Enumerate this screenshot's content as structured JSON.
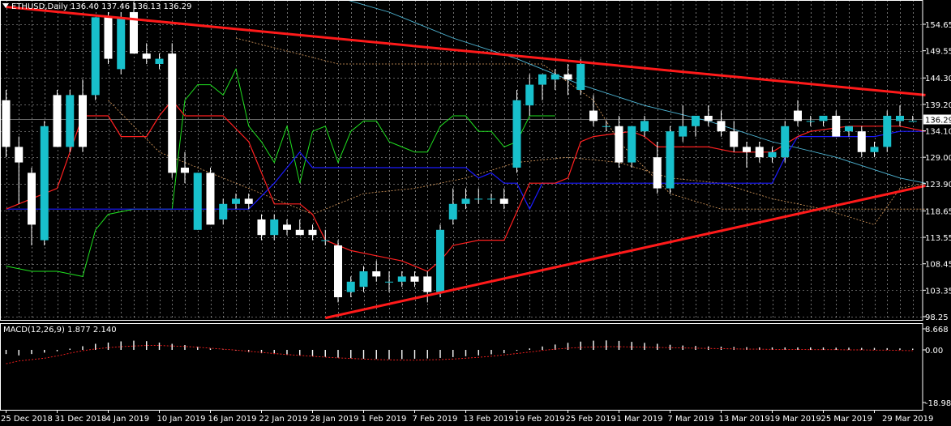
{
  "header": {
    "main_info": "ETHUSD,Daily  136.40 137.46 136.13 136.29",
    "macd_info": "MACD(12,26,9) 1.877 2.140",
    "last_price_label": "136.29"
  },
  "colors": {
    "background": "#000000",
    "frame": "#ffffff",
    "grid": "#ffffff",
    "bull_candle": "#18c0cc",
    "bear_candle": "#ffffff",
    "trendline": "#ff1a1a",
    "tenkan": "#ff2020",
    "kijun": "#1a1aff",
    "chikou": "#20e020",
    "sma": "#4fb8d8",
    "senkou": "#e0a060",
    "macd_signal": "#ff2020",
    "macd_hist": "#ffffff"
  },
  "chart_data": [
    {
      "type": "candlestick",
      "symbol": "ETHUSD",
      "timeframe": "Daily",
      "ylim": [
        98.25,
        159.9
      ],
      "y_ticks": [
        "154.65",
        "149.55",
        "144.30",
        "139.20",
        "134.10",
        "129.00",
        "123.90",
        "118.65",
        "113.55",
        "108.45",
        "103.35",
        "98.25"
      ],
      "last_price": 136.29,
      "x_labels": [
        "25 Dec 2018",
        "31 Dec 2018",
        "4 Jan 2019",
        "10 Jan 2019",
        "16 Jan 2019",
        "22 Jan 2019",
        "28 Jan 2019",
        "1 Feb 2019",
        "7 Feb 2019",
        "13 Feb 2019",
        "19 Feb 2019",
        "25 Feb 2019",
        "1 Mar 2019",
        "7 Mar 2019",
        "13 Mar 2019",
        "19 Mar 2019",
        "25 Mar 2019",
        "29 Mar 2019"
      ],
      "candles": [
        {
          "o": 140,
          "h": 142,
          "l": 129,
          "c": 131
        },
        {
          "o": 131,
          "h": 133,
          "l": 120,
          "c": 128
        },
        {
          "o": 126,
          "h": 127,
          "l": 112,
          "c": 116
        },
        {
          "o": 113,
          "h": 136,
          "l": 112,
          "c": 135
        },
        {
          "o": 141,
          "h": 142,
          "l": 131,
          "c": 131
        },
        {
          "o": 131,
          "h": 142,
          "l": 130,
          "c": 141
        },
        {
          "o": 141,
          "h": 144,
          "l": 130,
          "c": 131
        },
        {
          "o": 141,
          "h": 156,
          "l": 140,
          "c": 156
        },
        {
          "o": 156,
          "h": 157,
          "l": 147,
          "c": 148
        },
        {
          "o": 146,
          "h": 157,
          "l": 145,
          "c": 156
        },
        {
          "o": 157,
          "h": 159,
          "l": 149,
          "c": 149
        },
        {
          "o": 149,
          "h": 151,
          "l": 147,
          "c": 148
        },
        {
          "o": 147,
          "h": 149,
          "l": 146,
          "c": 148
        },
        {
          "o": 149,
          "h": 151,
          "l": 125,
          "c": 126
        },
        {
          "o": 127,
          "h": 130,
          "l": 124,
          "c": 126
        },
        {
          "o": 115,
          "h": 126,
          "l": 115,
          "c": 126
        },
        {
          "o": 126,
          "h": 127,
          "l": 116,
          "c": 116
        },
        {
          "o": 117,
          "h": 121,
          "l": 116,
          "c": 120
        },
        {
          "o": 120,
          "h": 122,
          "l": 119,
          "c": 121
        },
        {
          "o": 121,
          "h": 122,
          "l": 119,
          "c": 120
        },
        {
          "o": 117,
          "h": 118,
          "l": 113,
          "c": 114
        },
        {
          "o": 114,
          "h": 118,
          "l": 113,
          "c": 117
        },
        {
          "o": 116,
          "h": 117,
          "l": 114,
          "c": 115
        },
        {
          "o": 115,
          "h": 117,
          "l": 114,
          "c": 114
        },
        {
          "o": 115,
          "h": 116,
          "l": 113,
          "c": 114
        },
        {
          "o": 113,
          "h": 115,
          "l": 112,
          "c": 113
        },
        {
          "o": 112,
          "h": 113,
          "l": 101,
          "c": 102
        },
        {
          "o": 103,
          "h": 106,
          "l": 102,
          "c": 105
        },
        {
          "o": 104,
          "h": 108,
          "l": 103,
          "c": 107
        },
        {
          "o": 107,
          "h": 109,
          "l": 105,
          "c": 106
        },
        {
          "o": 105,
          "h": 107,
          "l": 103,
          "c": 105
        },
        {
          "o": 105,
          "h": 107,
          "l": 104,
          "c": 106
        },
        {
          "o": 106,
          "h": 107,
          "l": 104,
          "c": 105
        },
        {
          "o": 106,
          "h": 107,
          "l": 101,
          "c": 103
        },
        {
          "o": 103,
          "h": 116,
          "l": 102,
          "c": 115
        },
        {
          "o": 117,
          "h": 123,
          "l": 116,
          "c": 120
        },
        {
          "o": 120,
          "h": 123,
          "l": 119,
          "c": 121
        },
        {
          "o": 121,
          "h": 123,
          "l": 120,
          "c": 121
        },
        {
          "o": 121,
          "h": 122,
          "l": 120,
          "c": 121
        },
        {
          "o": 121,
          "h": 123,
          "l": 119,
          "c": 120
        },
        {
          "o": 127,
          "h": 142,
          "l": 126,
          "c": 140
        },
        {
          "o": 139,
          "h": 145,
          "l": 137,
          "c": 143
        },
        {
          "o": 143,
          "h": 145,
          "l": 140,
          "c": 145
        },
        {
          "o": 144,
          "h": 146,
          "l": 142,
          "c": 145
        },
        {
          "o": 145,
          "h": 147,
          "l": 141,
          "c": 144
        },
        {
          "o": 142,
          "h": 148,
          "l": 141,
          "c": 147
        },
        {
          "o": 138,
          "h": 141,
          "l": 135,
          "c": 136
        },
        {
          "o": 135,
          "h": 136,
          "l": 134,
          "c": 135
        },
        {
          "o": 135,
          "h": 137,
          "l": 127,
          "c": 128
        },
        {
          "o": 128,
          "h": 135,
          "l": 127,
          "c": 135
        },
        {
          "o": 134,
          "h": 137,
          "l": 133,
          "c": 136
        },
        {
          "o": 129,
          "h": 132,
          "l": 122,
          "c": 123
        },
        {
          "o": 123,
          "h": 135,
          "l": 122,
          "c": 134
        },
        {
          "o": 133,
          "h": 139,
          "l": 132,
          "c": 135
        },
        {
          "o": 135,
          "h": 137,
          "l": 133,
          "c": 137
        },
        {
          "o": 137,
          "h": 139,
          "l": 135,
          "c": 136
        },
        {
          "o": 136,
          "h": 138,
          "l": 133,
          "c": 134
        },
        {
          "o": 134,
          "h": 136,
          "l": 130,
          "c": 131
        },
        {
          "o": 131,
          "h": 132,
          "l": 127,
          "c": 130
        },
        {
          "o": 131,
          "h": 132,
          "l": 128,
          "c": 129
        },
        {
          "o": 129,
          "h": 131,
          "l": 128,
          "c": 130
        },
        {
          "o": 129,
          "h": 136,
          "l": 128,
          "c": 135
        },
        {
          "o": 138,
          "h": 140,
          "l": 135,
          "c": 136
        },
        {
          "o": 136,
          "h": 137,
          "l": 135,
          "c": 136
        },
        {
          "o": 136,
          "h": 137,
          "l": 135,
          "c": 137
        },
        {
          "o": 137,
          "h": 138,
          "l": 133,
          "c": 133
        },
        {
          "o": 134,
          "h": 135,
          "l": 133,
          "c": 135
        },
        {
          "o": 134,
          "h": 135,
          "l": 129,
          "c": 130
        },
        {
          "o": 130,
          "h": 132,
          "l": 129,
          "c": 131
        },
        {
          "o": 131,
          "h": 138,
          "l": 130,
          "c": 137
        },
        {
          "o": 136,
          "h": 139,
          "l": 135,
          "c": 137
        },
        {
          "o": 136,
          "h": 137,
          "l": 136,
          "c": 136
        }
      ],
      "overlays": {
        "trendline_upper": [
          [
            0,
            158
          ],
          [
            72,
            141
          ]
        ],
        "trendline_lower": [
          [
            25,
            98
          ],
          [
            72,
            123.5
          ]
        ],
        "kijun_sen": [
          [
            0,
            119
          ],
          [
            12,
            119
          ],
          [
            15,
            119
          ],
          [
            19,
            119
          ],
          [
            21,
            124
          ],
          [
            23,
            130
          ],
          [
            24,
            127
          ],
          [
            26,
            127
          ],
          [
            33,
            127
          ],
          [
            36,
            127
          ],
          [
            37,
            125
          ],
          [
            38,
            126
          ],
          [
            39,
            124
          ],
          [
            40,
            124
          ],
          [
            41,
            119
          ],
          [
            42,
            124
          ],
          [
            50,
            124
          ],
          [
            60,
            124
          ],
          [
            61,
            129
          ],
          [
            62,
            133
          ],
          [
            68,
            133
          ],
          [
            70,
            134
          ],
          [
            72,
            134
          ]
        ],
        "tenkan_sen": [
          [
            0,
            119
          ],
          [
            4,
            123
          ],
          [
            6,
            137
          ],
          [
            8,
            137
          ],
          [
            9,
            133
          ],
          [
            10,
            133
          ],
          [
            11,
            133
          ],
          [
            12,
            137
          ],
          [
            13,
            140
          ],
          [
            14,
            137
          ],
          [
            17,
            137
          ],
          [
            19,
            132
          ],
          [
            21,
            120
          ],
          [
            23,
            120
          ],
          [
            24,
            118
          ],
          [
            25,
            113
          ],
          [
            27,
            111
          ],
          [
            29,
            110
          ],
          [
            31,
            109
          ],
          [
            32,
            108
          ],
          [
            33,
            107
          ],
          [
            34,
            109
          ],
          [
            35,
            112
          ],
          [
            37,
            113
          ],
          [
            39,
            113
          ],
          [
            41,
            124
          ],
          [
            42,
            124
          ],
          [
            43,
            124
          ],
          [
            44,
            125
          ],
          [
            45,
            132
          ],
          [
            46,
            133
          ],
          [
            49,
            134
          ],
          [
            50,
            133
          ],
          [
            51,
            131
          ],
          [
            53,
            131
          ],
          [
            55,
            131
          ],
          [
            57,
            130
          ],
          [
            60,
            130
          ],
          [
            62,
            133
          ],
          [
            63,
            134
          ],
          [
            66,
            135
          ],
          [
            70,
            135
          ],
          [
            72,
            134
          ]
        ],
        "chikou_span": [
          [
            0,
            108
          ],
          [
            2,
            107
          ],
          [
            4,
            107
          ],
          [
            6,
            106
          ],
          [
            7,
            115
          ],
          [
            8,
            118
          ],
          [
            10,
            119
          ],
          [
            12,
            119
          ],
          [
            13,
            119
          ],
          [
            14,
            140
          ],
          [
            15,
            143
          ],
          [
            16,
            143
          ],
          [
            17,
            141
          ],
          [
            18,
            146
          ],
          [
            19,
            135
          ],
          [
            20,
            132
          ],
          [
            21,
            128
          ],
          [
            22,
            135
          ],
          [
            23,
            124
          ],
          [
            24,
            134
          ],
          [
            25,
            135
          ],
          [
            26,
            128
          ],
          [
            27,
            134
          ],
          [
            28,
            136
          ],
          [
            29,
            136
          ],
          [
            30,
            132
          ],
          [
            31,
            131
          ],
          [
            32,
            130
          ],
          [
            33,
            130
          ],
          [
            34,
            135
          ],
          [
            35,
            137
          ],
          [
            36,
            137
          ],
          [
            37,
            134
          ],
          [
            38,
            134
          ],
          [
            39,
            131
          ],
          [
            40,
            132
          ],
          [
            41,
            137
          ],
          [
            42,
            137
          ],
          [
            43,
            137
          ]
        ],
        "sma": [
          [
            23,
            162
          ],
          [
            30,
            157
          ],
          [
            35,
            152
          ],
          [
            40,
            148
          ],
          [
            45,
            143
          ],
          [
            50,
            139
          ],
          [
            55,
            136
          ],
          [
            60,
            132
          ],
          [
            65,
            129
          ],
          [
            70,
            125
          ],
          [
            72,
            124
          ]
        ],
        "senkou_a": [
          [
            8,
            140
          ],
          [
            12,
            130
          ],
          [
            16,
            126
          ],
          [
            20,
            122
          ],
          [
            24,
            118
          ],
          [
            28,
            122
          ],
          [
            32,
            123
          ],
          [
            36,
            125
          ],
          [
            40,
            128
          ],
          [
            44,
            129
          ],
          [
            48,
            128
          ],
          [
            52,
            125
          ],
          [
            56,
            124
          ],
          [
            60,
            121
          ],
          [
            64,
            119
          ],
          [
            68,
            116
          ],
          [
            70,
            123
          ],
          [
            72,
            124
          ]
        ],
        "senkou_b": [
          [
            18,
            152
          ],
          [
            26,
            147
          ],
          [
            30,
            147
          ],
          [
            34,
            147
          ],
          [
            38,
            147
          ],
          [
            42,
            147
          ],
          [
            46,
            140
          ],
          [
            48,
            132
          ],
          [
            52,
            122
          ],
          [
            56,
            119
          ],
          [
            60,
            119
          ],
          [
            64,
            119
          ],
          [
            68,
            119
          ],
          [
            72,
            119
          ]
        ]
      }
    },
    {
      "type": "bar",
      "indicator": "MACD(12,26,9)",
      "ylim": [
        -18.981,
        8.668
      ],
      "y_ticks": [
        "8.668",
        "0.00",
        "-18.981"
      ],
      "histogram": [
        -1.5,
        -2,
        -1.5,
        -1,
        -0.5,
        0.5,
        1.5,
        2.5,
        3,
        3.5,
        3.8,
        3.6,
        3,
        2.5,
        2,
        1.3,
        0.6,
        0.1,
        -0.3,
        -0.8,
        -1.2,
        -1.5,
        -1.8,
        -2,
        -2.3,
        -2.5,
        -2.8,
        -3,
        -3.2,
        -3.3,
        -3.4,
        -3.3,
        -3.2,
        -3.1,
        -2.9,
        -2.6,
        -2.3,
        -2,
        -1.6,
        -1.2,
        -0.3,
        0.6,
        1.4,
        2.2,
        2.9,
        3.4,
        3.8,
        3.9,
        3.7,
        3.3,
        2.9,
        2.5,
        2.1,
        1.8,
        1.6,
        1.4,
        1.3,
        1.2,
        1.1,
        1,
        1,
        1,
        1,
        1,
        1,
        0.9,
        0.9,
        0.8,
        0.8,
        0.7,
        0.6,
        0.5
      ],
      "signal": [
        -5,
        -4,
        -3.5,
        -3,
        -2.2,
        -1.2,
        -0.3,
        0.4,
        0.9,
        1.3,
        1.6,
        1.8,
        1.8,
        1.6,
        1.4,
        1.1,
        0.7,
        0.3,
        -0.1,
        -0.5,
        -0.9,
        -1.3,
        -1.7,
        -2,
        -2.3,
        -2.6,
        -2.9,
        -3.1,
        -3.3,
        -3.5,
        -3.6,
        -3.7,
        -3.7,
        -3.6,
        -3.5,
        -3.3,
        -3,
        -2.7,
        -2.3,
        -1.8,
        -1.3,
        -0.8,
        -0.2,
        0.3,
        0.7,
        1,
        1.2,
        1.3,
        1.3,
        1.2,
        1.1,
        1,
        0.9,
        0.8,
        0.7,
        0.6,
        0.5,
        0.4,
        0.3,
        0.3,
        0.2,
        0.2,
        0.2,
        0.1,
        0.1,
        0.1,
        0,
        0,
        -0.1,
        -0.1,
        -0.2,
        -0.3
      ]
    }
  ]
}
